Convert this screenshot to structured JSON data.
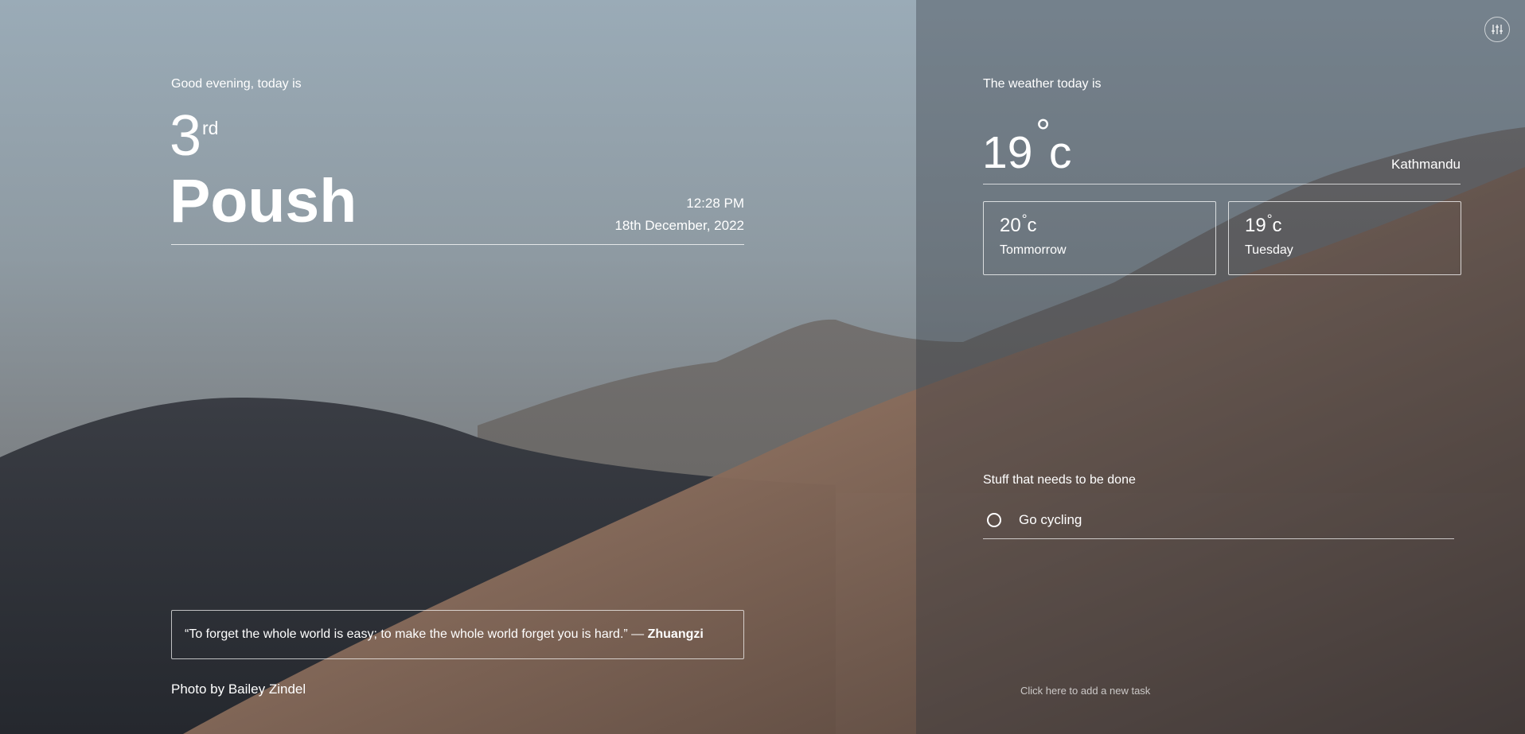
{
  "greeting": {
    "intro": "Good evening, today is",
    "day_number": "3",
    "day_suffix": "rd",
    "month": "Poush",
    "time": "12:28 PM",
    "date": "18th December, 2022"
  },
  "quote": {
    "text": "“To forget the whole world is easy; to make the whole world forget you is hard.” — ",
    "author": "Zhuangzi"
  },
  "photo_credit": "Photo by Bailey Zindel",
  "settings": {
    "icon": "sliders-icon"
  },
  "weather": {
    "heading": "The weather today is",
    "temp": "19",
    "degree_symbol": "°",
    "unit": "c",
    "location": "Kathmandu",
    "forecast": [
      {
        "temp": "20",
        "label": "Tommorrow"
      },
      {
        "temp": "19",
        "label": "Tuesday"
      }
    ]
  },
  "todo": {
    "heading": "Stuff that needs to be done",
    "items": [
      {
        "label": "Go cycling",
        "done": false
      }
    ],
    "add_prompt": "Click here to add a new task"
  }
}
